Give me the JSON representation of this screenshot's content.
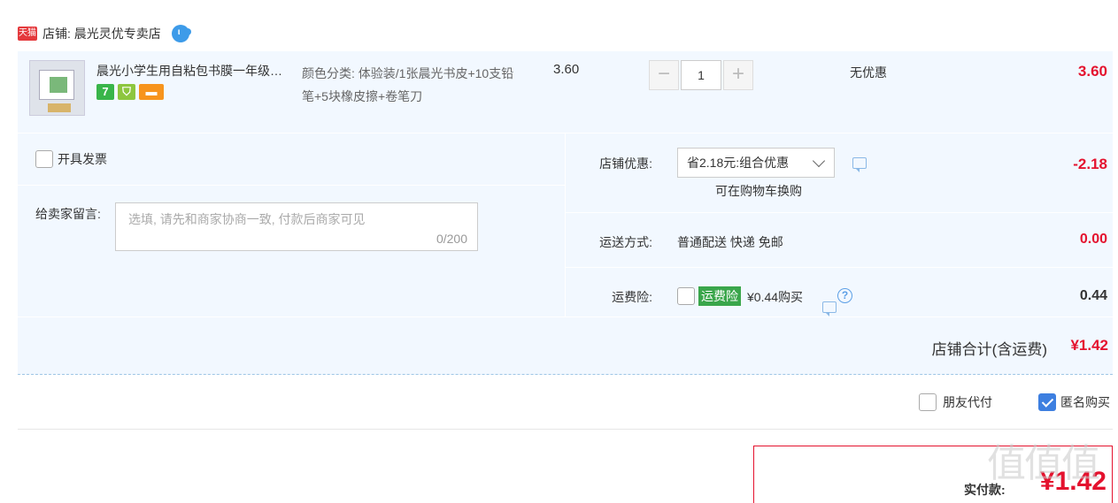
{
  "shop": {
    "badge": "天猫",
    "name": "店铺: 晨光灵优专卖店"
  },
  "item": {
    "title": "晨光小学生用自粘包书膜一年级…",
    "spec": "颜色分类: 体验装/1张晨光书皮+10支铅笔+5块橡皮擦+卷笔刀",
    "unit_price": "3.60",
    "quantity": "1",
    "discount": "无优惠",
    "total": "3.60",
    "tags": [
      "7",
      "⛉",
      "▬"
    ]
  },
  "invoice": {
    "label": "开具发票"
  },
  "message": {
    "label": "给卖家留言:",
    "placeholder": "选填, 请先和商家协商一致, 付款后商家可见",
    "count": "0/200"
  },
  "shop_discount": {
    "label": "店铺优惠:",
    "selected": "省2.18元:组合优惠",
    "note": "可在购物车换购",
    "amount": "-2.18"
  },
  "shipping": {
    "label": "运送方式:",
    "value": "普通配送 快递 免邮",
    "amount": "0.00"
  },
  "insurance": {
    "label": "运费险:",
    "badge": "运费险",
    "price": "¥0.44购买",
    "help": "?",
    "amount": "0.44"
  },
  "shop_total": {
    "label": "店铺合计(含运费)",
    "amount": "¥1.42"
  },
  "options": {
    "friend_pay": "朋友代付",
    "anonymous": "匿名购买"
  },
  "payment": {
    "label": "实付款:",
    "amount": "¥1.42"
  },
  "watermark": "值值值",
  "colors": {
    "accent": "#e4122e",
    "panel_bg": "#f2f8ff",
    "checkbox_blue": "#3d7fe0",
    "insurance_green": "#3aa64b"
  }
}
